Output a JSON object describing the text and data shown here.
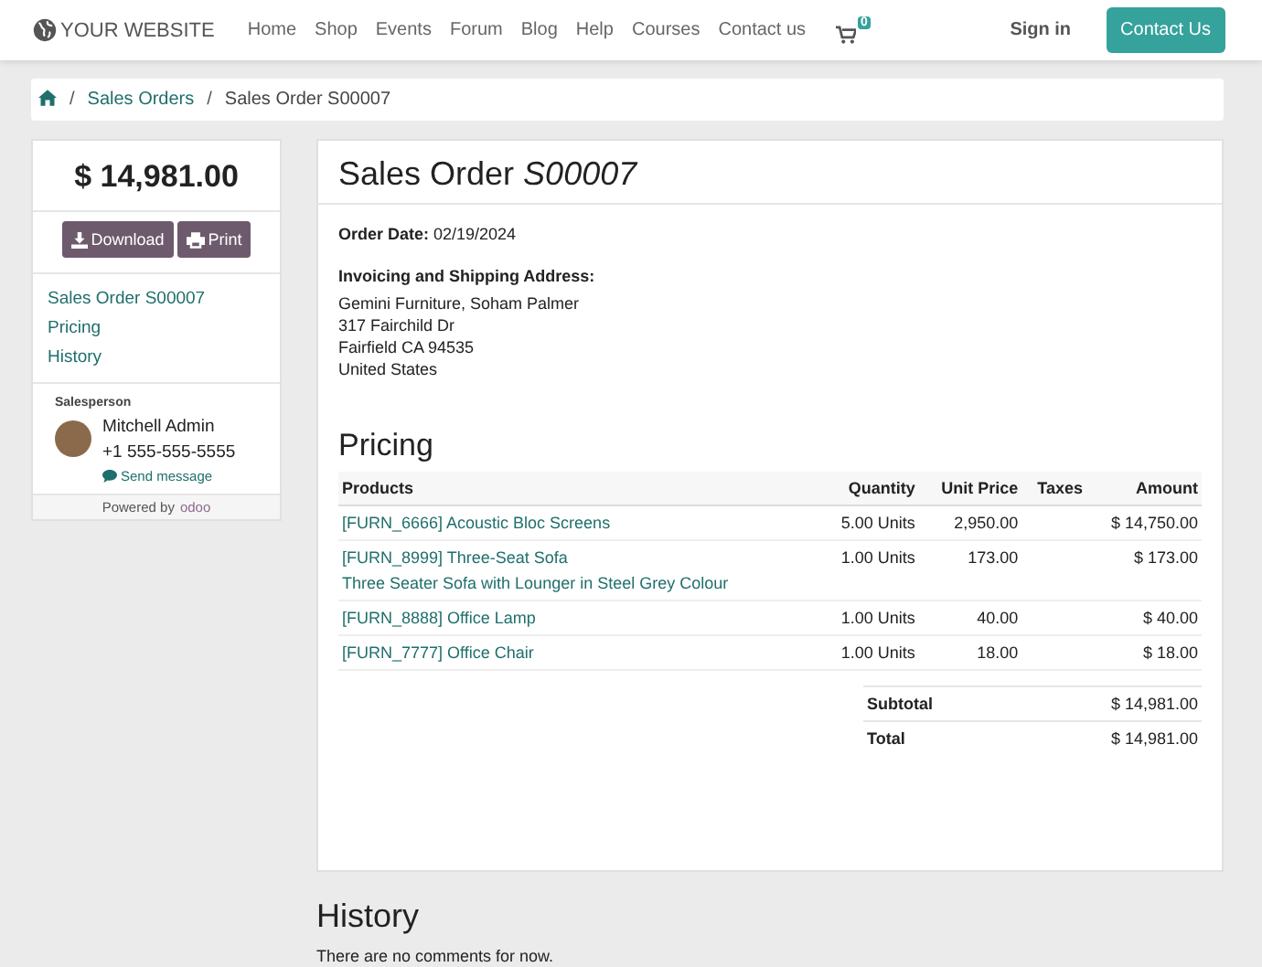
{
  "header": {
    "logo": "YOUR WEBSITE",
    "menu": [
      {
        "label": "Home"
      },
      {
        "label": "Shop"
      },
      {
        "label": "Events"
      },
      {
        "label": "Forum"
      },
      {
        "label": "Blog"
      },
      {
        "label": "Help"
      },
      {
        "label": "Courses"
      },
      {
        "label": "Contact us"
      }
    ],
    "cart_count": "0",
    "sign_in": "Sign in",
    "contact_button": "Contact Us"
  },
  "breadcrumb": {
    "items": [
      {
        "label": "Sales Orders",
        "separator": "/"
      },
      {
        "label": "Sales Order S00007",
        "separator": "/"
      }
    ]
  },
  "sidebar": {
    "total": "$ 14,981.00",
    "buttons": [
      {
        "kind": "download",
        "label": "Download"
      },
      {
        "kind": "print",
        "label": "Print"
      }
    ],
    "links": [
      "Sales Order S00007",
      "Pricing",
      "History"
    ],
    "salesperson_label": "Salesperson",
    "salesperson_name": "Mitchell Admin",
    "salesperson_phone": "+1 555-555-5555",
    "send_message": "Send message",
    "powered_by": "Powered by",
    "powered_brand": "odoo"
  },
  "order": {
    "title": "Sales Order *S00007*",
    "date_label": "Order Date:",
    "date": "02/19/2024",
    "address_label": "Invoicing and Shipping Address:",
    "address": [
      "Gemini Furniture, Soham Palmer",
      "317 Fairchild Dr",
      "Fairfield CA 94535",
      "United States"
    ],
    "pricing_title": "Pricing",
    "columns": [
      "Products",
      "Quantity",
      "Unit Price",
      "Taxes",
      "Amount"
    ],
    "rows": [
      {
        "product": "[FURN_6666] Acoustic Bloc Screens",
        "quantity": "5.00 Units",
        "unit_price": "2,950.00",
        "amount": "$ 14,750.00"
      },
      {
        "product": "[FURN_8999] Three-Seat Sofa",
        "description": "Three Seater Sofa with Lounger in Steel Grey Colour",
        "quantity": "1.00 Units",
        "unit_price": "173.00",
        "amount": "$ 173.00"
      },
      {
        "product": "[FURN_8888] Office Lamp",
        "quantity": "1.00 Units",
        "unit_price": "40.00",
        "amount": "$ 40.00"
      },
      {
        "product": "[FURN_7777] Office Chair",
        "quantity": "1.00 Units",
        "unit_price": "18.00",
        "amount": "$ 18.00"
      }
    ],
    "totals": [
      {
        "label": "Subtotal",
        "value": "$ 14,981.00"
      },
      {
        "label": "Total",
        "value": "$ 14,981.00"
      }
    ]
  },
  "history": {
    "title": "History",
    "text": "There are no comments for now."
  }
}
